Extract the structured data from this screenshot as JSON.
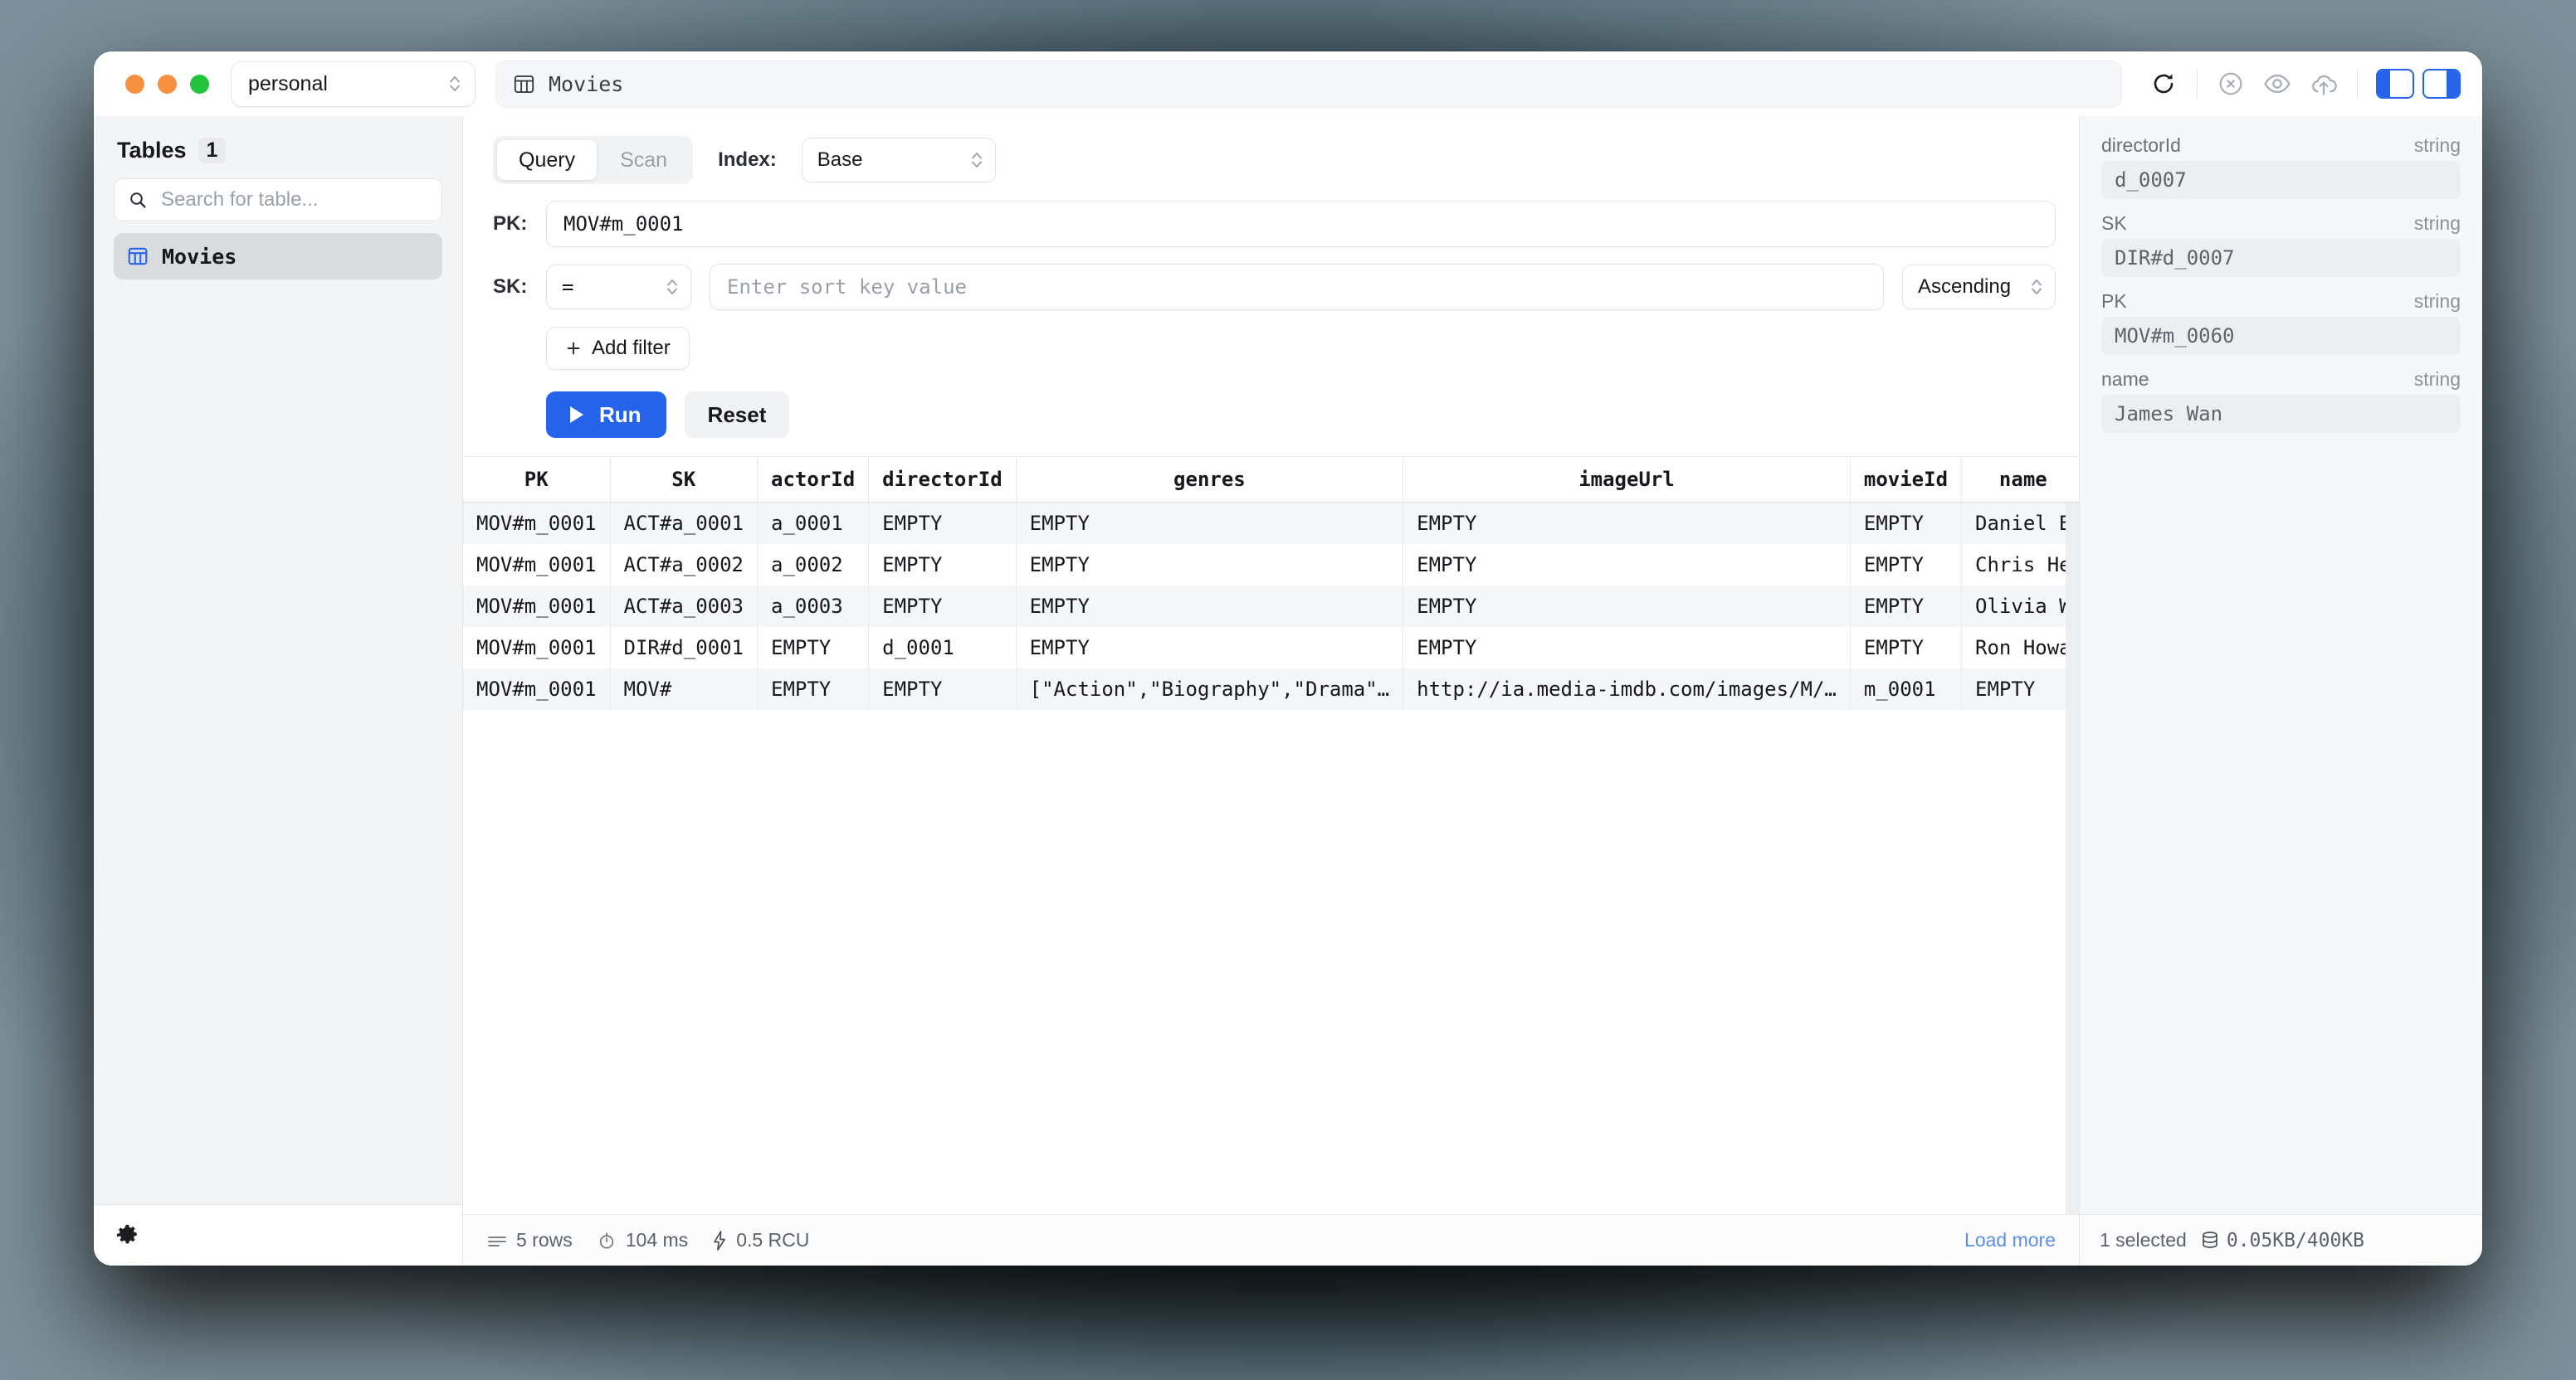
{
  "window": {
    "profile_selector": "personal",
    "table_pill": "Movies",
    "traffic_lights": [
      "close-button",
      "minimize-button",
      "maximize-button"
    ],
    "toolbar": {
      "refresh": "refresh-icon",
      "cancel": "cancel-circle-icon",
      "preview": "eye-icon",
      "upload": "cloud-upload-icon",
      "left_panel_toggle": "left-panel-toggle",
      "right_panel_toggle": "right-panel-toggle"
    },
    "accent_color": "#2563eb"
  },
  "sidebar": {
    "title": "Tables",
    "count": "1",
    "search_placeholder": "Search for table...",
    "search_value": "",
    "items": [
      {
        "label": "Movies",
        "icon": "table-icon",
        "active": true
      }
    ],
    "settings_icon": "gear-icon"
  },
  "query": {
    "mode_tabs": [
      {
        "label": "Query",
        "active": true
      },
      {
        "label": "Scan",
        "active": false
      }
    ],
    "index_label": "Index:",
    "index_value": "Base",
    "pk_label": "PK:",
    "pk_value": "MOV#m_0001",
    "sk_label": "SK:",
    "sk_operator": "=",
    "sk_placeholder": "Enter sort key value",
    "sk_value": "",
    "sort_order": "Ascending",
    "add_filter_label": "Add filter",
    "run_label": "Run",
    "reset_label": "Reset"
  },
  "results": {
    "columns": [
      "PK",
      "SK",
      "actorId",
      "directorId",
      "genres",
      "imageUrl",
      "movieId",
      "name"
    ],
    "empty_placeholder": "EMPTY",
    "rows": [
      {
        "PK": "MOV#m_0001",
        "SK": "ACT#a_0001",
        "actorId": "a_0001",
        "directorId": "EMPTY",
        "genres": "EMPTY",
        "imageUrl": "EMPTY",
        "movieId": "EMPTY",
        "name": "Daniel B"
      },
      {
        "PK": "MOV#m_0001",
        "SK": "ACT#a_0002",
        "actorId": "a_0002",
        "directorId": "EMPTY",
        "genres": "EMPTY",
        "imageUrl": "EMPTY",
        "movieId": "EMPTY",
        "name": "Chris He"
      },
      {
        "PK": "MOV#m_0001",
        "SK": "ACT#a_0003",
        "actorId": "a_0003",
        "directorId": "EMPTY",
        "genres": "EMPTY",
        "imageUrl": "EMPTY",
        "movieId": "EMPTY",
        "name": "Olivia W"
      },
      {
        "PK": "MOV#m_0001",
        "SK": "DIR#d_0001",
        "actorId": "EMPTY",
        "directorId": "d_0001",
        "genres": "EMPTY",
        "imageUrl": "EMPTY",
        "movieId": "EMPTY",
        "name": "Ron Howa"
      },
      {
        "PK": "MOV#m_0001",
        "SK": "MOV#",
        "actorId": "EMPTY",
        "directorId": "EMPTY",
        "genres": "[\"Action\",\"Biography\",\"Drama\"…",
        "imageUrl": "http://ia.media-imdb.com/images/M/…",
        "movieId": "m_0001",
        "name": "EMPTY"
      }
    ]
  },
  "statusbar": {
    "rows": "5 rows",
    "duration": "104 ms",
    "rcu": "0.5 RCU",
    "load_more": "Load more"
  },
  "detail": {
    "attributes": [
      {
        "name": "directorId",
        "type": "string",
        "value": "d_0007"
      },
      {
        "name": "SK",
        "type": "string",
        "value": "DIR#d_0007"
      },
      {
        "name": "PK",
        "type": "string",
        "value": "MOV#m_0060"
      },
      {
        "name": "name",
        "type": "string",
        "value": "James Wan"
      }
    ],
    "selected_text": "1 selected",
    "size_text": "0.05KB/400KB"
  }
}
